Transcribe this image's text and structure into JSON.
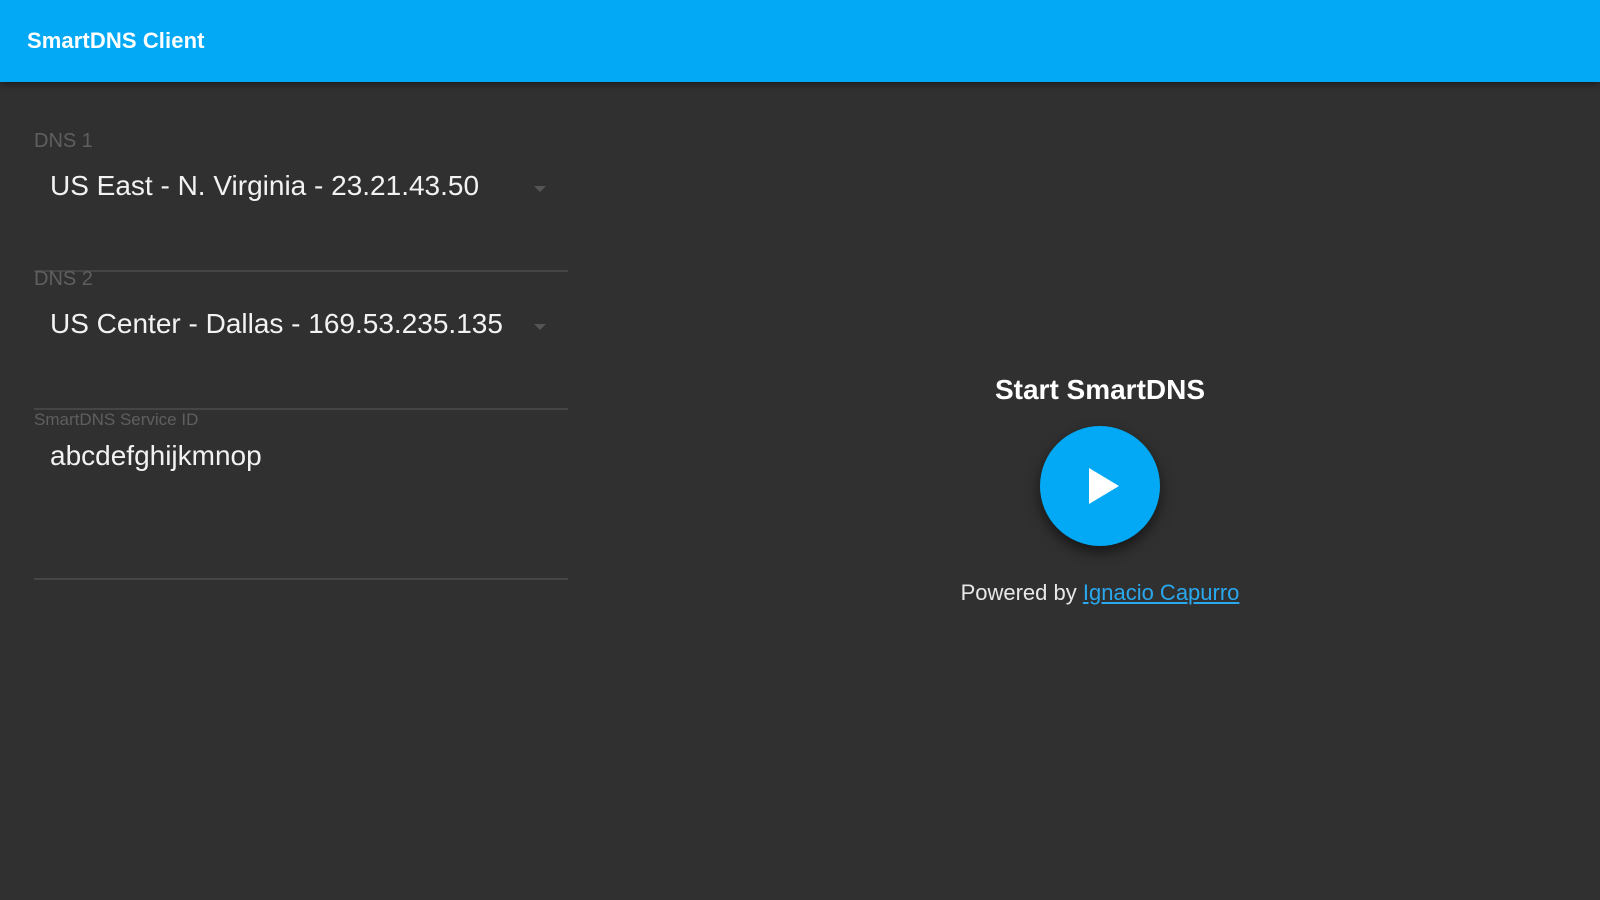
{
  "app_bar": {
    "title": "SmartDNS Client"
  },
  "form": {
    "dns1": {
      "label": "DNS 1",
      "value": "US East - N. Virginia - 23.21.43.50"
    },
    "dns2": {
      "label": "DNS 2",
      "value": "US Center - Dallas - 169.53.235.135"
    },
    "service_id": {
      "label": "SmartDNS Service ID",
      "value": "abcdefghijkmnop"
    }
  },
  "start_panel": {
    "title": "Start SmartDNS",
    "powered_prefix": "Powered by ",
    "powered_link": "Ignacio Capurro"
  },
  "colors": {
    "accent": "#03A9F4",
    "background": "#303030",
    "link": "#29A8EE"
  },
  "icons": {
    "play": "play-icon",
    "dropdown": "dropdown-arrow-icon"
  }
}
